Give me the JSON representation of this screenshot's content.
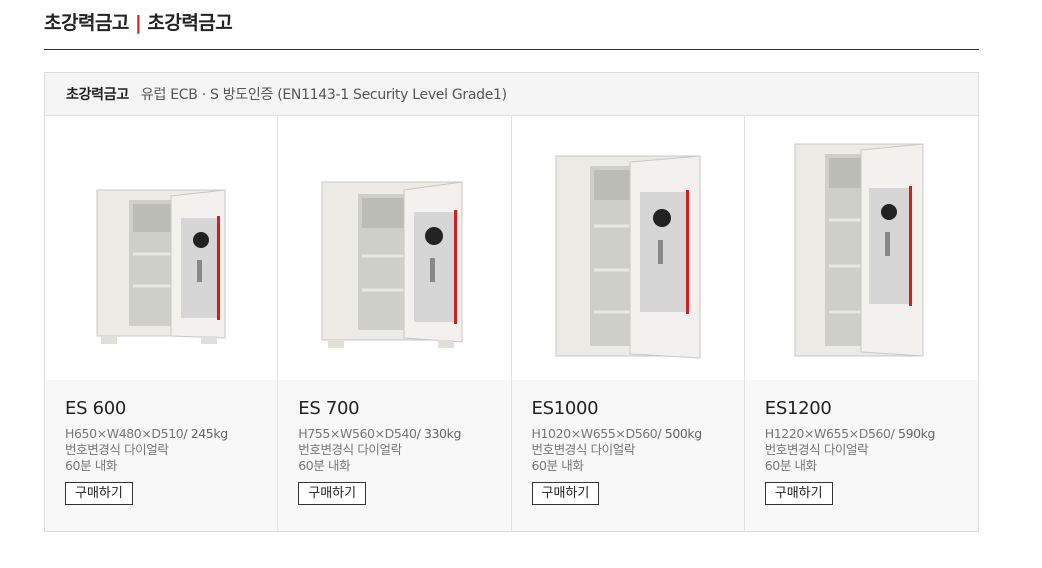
{
  "header": {
    "title_left": "초강력금고",
    "separator": "|",
    "title_right": "초강력금고"
  },
  "box": {
    "category": "초강력금고",
    "certification": "유럽 ECB · S 방도인증 (EN1143-1 Security Level Grade1)"
  },
  "products": [
    {
      "model": "ES 600",
      "dims": "H650×W480×D510",
      "weight": "/ 245kg",
      "lock": "번호변경식 다이얼락",
      "fire": "60분 내화",
      "buy_label": "구매하기"
    },
    {
      "model": "ES 700",
      "dims": "H755×W560×D540",
      "weight": "/ 330kg",
      "lock": "번호변경식 다이얼락",
      "fire": "60분 내화",
      "buy_label": "구매하기"
    },
    {
      "model": "ES1000",
      "dims": "H1020×W655×D560",
      "weight": "/ 500kg",
      "lock": "번호변경식 다이얼락",
      "fire": "60분 내화",
      "buy_label": "구매하기"
    },
    {
      "model": "ES1200",
      "dims": "H1220×W655×D560",
      "weight": "/ 590kg",
      "lock": "번호변경식 다이얼락",
      "fire": "60분 내화",
      "buy_label": "구매하기"
    }
  ],
  "colors": {
    "accent": "#d21e1e",
    "safe_body": "#ecebe6",
    "safe_panel": "#d9d9d9"
  }
}
